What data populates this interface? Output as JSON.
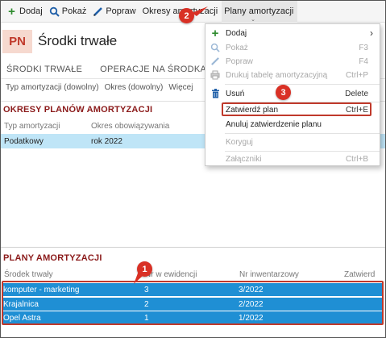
{
  "toolbar": {
    "add": "Dodaj",
    "show": "Pokaż",
    "edit": "Popraw",
    "periods": "Okresy amortyzacji",
    "plans": "Plany amortyzacji"
  },
  "header": {
    "badge": "PN",
    "title": "Środki trwałe"
  },
  "tabs": [
    "ŚRODKI TRWAŁE",
    "OPERACJE NA ŚRODKACH TRW"
  ],
  "filters": [
    "Typ amortyzacji (dowolny)",
    "Okres (dowolny)",
    "Więcej"
  ],
  "periods_section": {
    "title": "OKRESY PLANÓW AMORTYZACJI",
    "columns": [
      "Typ amortyzacji",
      "Okres obowiązywania"
    ],
    "rows": [
      [
        "Podatkowy",
        "rok 2022"
      ]
    ]
  },
  "plans_section": {
    "title": "PLANY AMORTYZACJI",
    "columns": [
      "Środek trwały",
      "Nr w ewidencji",
      "Nr inwentarzowy",
      "Zatwierd"
    ],
    "rows": [
      [
        "komputer - marketing",
        "3",
        "3/2022"
      ],
      [
        "Krajalnica",
        "2",
        "2/2022"
      ],
      [
        "Opel Astra",
        "1",
        "1/2022"
      ]
    ]
  },
  "menu": {
    "items": [
      {
        "label": "Dodaj",
        "key": "›",
        "icon": "plus-icon",
        "disabled": false
      },
      {
        "label": "Pokaż",
        "key": "F3",
        "icon": "search-icon",
        "disabled": true
      },
      {
        "label": "Popraw",
        "key": "F4",
        "icon": "pencil-icon",
        "disabled": true
      },
      {
        "label": "Drukuj tabelę amortyzacyjną",
        "key": "Ctrl+P",
        "icon": "print-icon",
        "disabled": true
      },
      {
        "label": "Usuń",
        "key": "Delete",
        "icon": "trash-icon",
        "disabled": false
      },
      {
        "label": "Zatwierdź plan",
        "key": "Ctrl+E",
        "icon": "",
        "disabled": false
      },
      {
        "label": "Anuluj zatwierdzenie planu",
        "key": "",
        "icon": "",
        "disabled": false
      },
      {
        "label": "Koryguj",
        "key": "",
        "icon": "",
        "disabled": true
      },
      {
        "label": "Załączniki",
        "key": "Ctrl+B",
        "icon": "",
        "disabled": true
      }
    ]
  },
  "callouts": [
    "2",
    "3",
    "1"
  ],
  "colors": {
    "accent_red": "#c0392b",
    "selection_blue": "#1f8fd4",
    "row_light_blue": "#bfe5f7"
  }
}
